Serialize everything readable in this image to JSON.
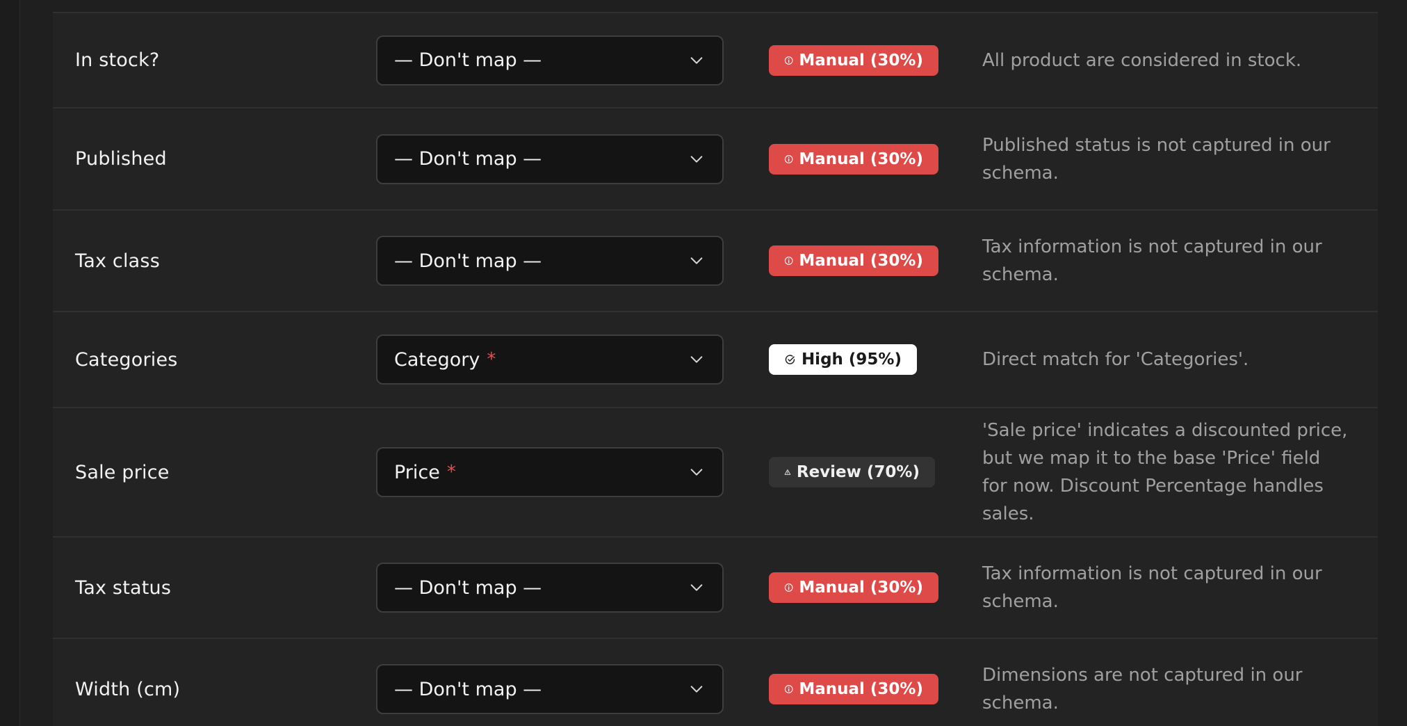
{
  "colors": {
    "manual": "#de4a48",
    "high": "#ffffff",
    "review": "#333333",
    "required": "#e05252"
  },
  "rows": [
    {
      "field": "In stock?",
      "mapping": "— Don't map —",
      "required": "",
      "confidence": {
        "kind": "manual",
        "icon": "info-circle-icon",
        "label": "Manual (30%)"
      },
      "description": "All product are considered in stock."
    },
    {
      "field": "Published",
      "mapping": "— Don't map —",
      "required": "",
      "confidence": {
        "kind": "manual",
        "icon": "info-circle-icon",
        "label": "Manual (30%)"
      },
      "description": "Published status is not captured in our schema."
    },
    {
      "field": "Tax class",
      "mapping": "— Don't map —",
      "required": "",
      "confidence": {
        "kind": "manual",
        "icon": "info-circle-icon",
        "label": "Manual (30%)"
      },
      "description": "Tax information is not captured in our schema."
    },
    {
      "field": "Categories",
      "mapping": "Category",
      "required": "*",
      "confidence": {
        "kind": "high",
        "icon": "check-circle-icon",
        "label": "High (95%)"
      },
      "description": "Direct match for 'Categories'."
    },
    {
      "field": "Sale price",
      "mapping": "Price",
      "required": "*",
      "confidence": {
        "kind": "review",
        "icon": "warning-triangle-icon",
        "label": "Review (70%)"
      },
      "description": "'Sale price' indicates a discounted price, but we map it to the base 'Price' field for now. Discount Percentage handles sales."
    },
    {
      "field": "Tax status",
      "mapping": "— Don't map —",
      "required": "",
      "confidence": {
        "kind": "manual",
        "icon": "info-circle-icon",
        "label": "Manual (30%)"
      },
      "description": "Tax information is not captured in our schema."
    },
    {
      "field": "Width (cm)",
      "mapping": "— Don't map —",
      "required": "",
      "confidence": {
        "kind": "manual",
        "icon": "info-circle-icon",
        "label": "Manual (30%)"
      },
      "description": "Dimensions are not captured in our schema."
    }
  ]
}
